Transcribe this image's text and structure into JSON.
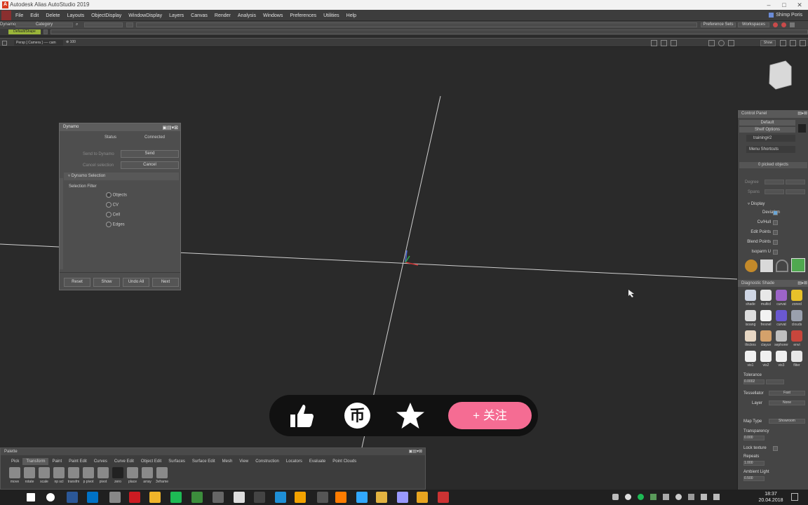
{
  "window": {
    "title": "Autodesk Alias AutoStudio 2019",
    "app_icon": "A"
  },
  "menu": {
    "items": [
      "File",
      "Edit",
      "Delete",
      "Layouts",
      "ObjectDisplay",
      "WindowDisplay",
      "Layers",
      "Canvas",
      "Render",
      "Analysis",
      "Windows",
      "Preferences",
      "Utilities",
      "Help"
    ],
    "user": "Shimp Poris"
  },
  "shelf": {
    "dynamo_label": "Dynamo",
    "category_label": "Category",
    "active_shelf": "Default/Shape",
    "right_buttons": [
      "Preference Sets",
      "Workspaces"
    ]
  },
  "viewport": {
    "label": "Persp [ Camera ] ---- cam",
    "zoom": "100",
    "show_button": "Show"
  },
  "dynamo_panel": {
    "title": "Dynamo",
    "status_label": "Status",
    "status_value": "Connected",
    "send_label": "Send to Dynamo",
    "send_button": "Send",
    "cancel_label": "Cancel selection",
    "cancel_button": "Cancel",
    "section": "Dynamo Selection",
    "filter_label": "Selection Filter",
    "filters": [
      {
        "label": "Objects",
        "selected": true
      },
      {
        "label": "CV",
        "selected": false
      },
      {
        "label": "Cell",
        "selected": false
      },
      {
        "label": "Edges",
        "selected": false
      }
    ],
    "buttons": [
      "Reset",
      "Show",
      "Undo All",
      "Next"
    ]
  },
  "control_panel": {
    "title": "Control Panel",
    "default_label": "Default",
    "shelf_options": "Shelf Options",
    "tab": "training#2",
    "menu_shortcuts": "Menu Shortcuts",
    "picked": "0 picked objects",
    "degree_label": "Degree",
    "spans_label": "Spans",
    "display_label": "Display",
    "display_items": [
      {
        "label": "Deviation",
        "checked": true
      },
      {
        "label": "Cv/Hull",
        "checked": false
      },
      {
        "label": "Edit Points",
        "checked": false
      },
      {
        "label": "Blend Points",
        "checked": false
      },
      {
        "label": "Isoparm U",
        "checked": false
      }
    ],
    "tools_row": [
      "stencil",
      "scope",
      "curve",
      "brush"
    ],
    "diag_title": "Diagnostic Shade",
    "shades": [
      {
        "name": "shade",
        "color": "#cfd6e4"
      },
      {
        "name": "multicl",
        "color": "#e8e8e8"
      },
      {
        "name": "curvat",
        "color": "#9c64c8"
      },
      {
        "name": "zoned",
        "color": "#e8c12a"
      },
      {
        "name": "isoang",
        "color": "#dddddd"
      },
      {
        "name": "fresnel",
        "color": "#f2f2f2"
      },
      {
        "name": "curvat",
        "color": "#6a58d0"
      },
      {
        "name": "clouds",
        "color": "#9aa0ad"
      },
      {
        "name": "thickns",
        "color": "#e7d7c4"
      },
      {
        "name": "clayuv",
        "color": "#d4a16b"
      },
      {
        "name": "sephorer",
        "color": "#bfbfbf"
      },
      {
        "name": "envi",
        "color": "#c8463c"
      },
      {
        "name": "vis1",
        "color": "#f0f0f0"
      },
      {
        "name": "vis2",
        "color": "#f0f0f0"
      },
      {
        "name": "vis3",
        "color": "#f0f0f0"
      },
      {
        "name": "fliter",
        "color": "#e6e6e6"
      }
    ],
    "tolerance_label": "Tolerance",
    "tolerance_value": "0.0002",
    "tessellator_label": "Tessellator",
    "tessellator_value": "Fast",
    "layer_label": "Layer",
    "layer_value": "None",
    "map_type_label": "Map Type",
    "map_type_value": "Showroom",
    "transparency_label": "Transparency",
    "transparency_value": "0.000",
    "lock_texture_label": "Lock texture",
    "repeats_label": "Repeats",
    "repeats_value": "1.000",
    "ambient_label": "Ambient Light",
    "ambient_value": "0.500"
  },
  "palette": {
    "title": "Palette",
    "tabs": [
      "Pick",
      "Transform",
      "Paint",
      "Paint Edit",
      "Curves",
      "Curve Edit",
      "Object Edit",
      "Surfaces",
      "Surface Edit",
      "Mesh",
      "View",
      "Construction",
      "Locators",
      "Evaluate",
      "Point Clouds"
    ],
    "active_tab": "Transform",
    "tools": [
      "move",
      "rotate",
      "scale",
      "np scl",
      "transfm",
      "p pivot",
      "pivot",
      "zero",
      "place",
      "array",
      "3vframe"
    ]
  },
  "taskbar": {
    "time": "18:37",
    "date": "20.04.2018",
    "apps": [
      {
        "name": "windows-start",
        "color": "#ffffff"
      },
      {
        "name": "search",
        "color": "#ffffff"
      },
      {
        "name": "word",
        "color": "#2b5797"
      },
      {
        "name": "outlook",
        "color": "#0072c6"
      },
      {
        "name": "app",
        "color": "#888888"
      },
      {
        "name": "opera",
        "color": "#cc1b22"
      },
      {
        "name": "chrome",
        "color": "#f0b42a"
      },
      {
        "name": "spotify",
        "color": "#1db954"
      },
      {
        "name": "app-green",
        "color": "#3c8d3c"
      },
      {
        "name": "app-gray",
        "color": "#666666"
      },
      {
        "name": "app-white",
        "color": "#dddddd"
      },
      {
        "name": "terminal",
        "color": "#444444"
      },
      {
        "name": "explorer",
        "color": "#1e8fd6"
      },
      {
        "name": "sketch",
        "color": "#f2a200"
      },
      {
        "name": "app-dark",
        "color": "#555555"
      },
      {
        "name": "illustrator",
        "color": "#ff7c00"
      },
      {
        "name": "photoshop",
        "color": "#31a8ff"
      },
      {
        "name": "app-folder",
        "color": "#e3b341"
      },
      {
        "name": "premiere",
        "color": "#9999ff"
      },
      {
        "name": "alias",
        "color": "#e8a520"
      },
      {
        "name": "app-red",
        "color": "#cc3333"
      }
    ]
  },
  "overlay": {
    "follow_label": "+ 关注",
    "coin_symbol": "币"
  }
}
